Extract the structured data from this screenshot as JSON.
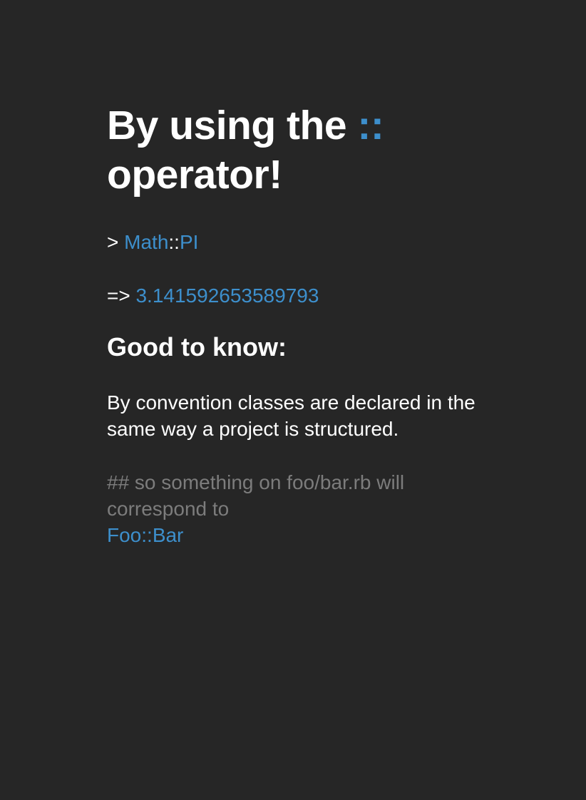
{
  "title": {
    "prefix": "By using the",
    "operator": "::",
    "suffix": "operator!"
  },
  "code_input": {
    "prompt": ">",
    "receiver": "Math",
    "operator": "::",
    "constant": "PI"
  },
  "code_output": {
    "arrow": "=>",
    "value": "3.141592653589793"
  },
  "note": {
    "heading": "Good to know:",
    "body": "By convention classes are declared in the same way a project is structured.",
    "comment": "## so something on foo/bar.rb will correspond to",
    "example_module": "Foo",
    "example_operator": "::",
    "example_class": "Bar"
  },
  "colors": {
    "background": "#262626",
    "text": "#ffffff",
    "accent": "#3d8fcc",
    "comment": "#7c7c7c"
  }
}
